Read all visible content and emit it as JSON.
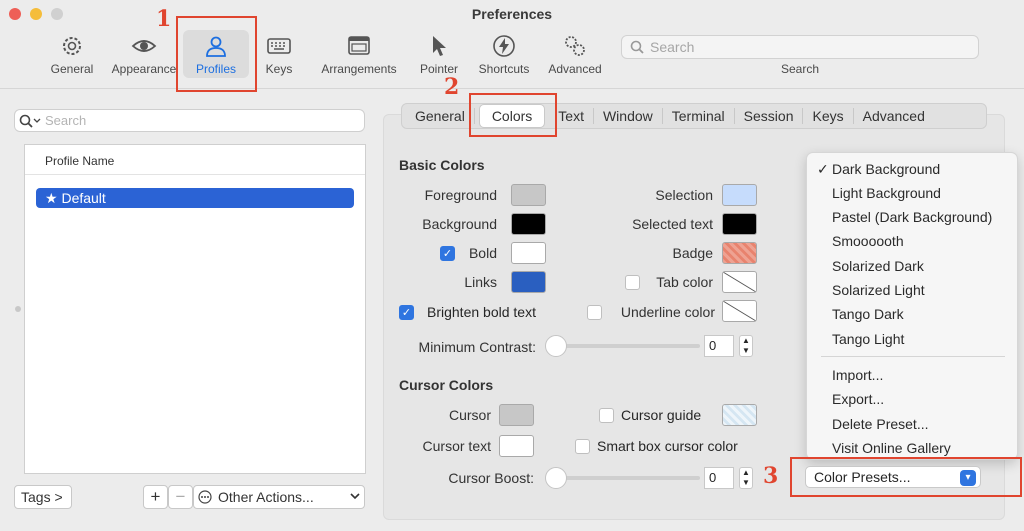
{
  "window": {
    "title": "Preferences"
  },
  "toolbar": [
    {
      "label": "General",
      "icon": "gear-icon"
    },
    {
      "label": "Appearance",
      "icon": "eye-icon"
    },
    {
      "label": "Profiles",
      "icon": "person-icon"
    },
    {
      "label": "Keys",
      "icon": "keyboard-icon"
    },
    {
      "label": "Arrangements",
      "icon": "window-icon"
    },
    {
      "label": "Pointer",
      "icon": "pointer-icon"
    },
    {
      "label": "Shortcuts",
      "icon": "bolt-icon"
    },
    {
      "label": "Advanced",
      "icon": "gears-icon"
    }
  ],
  "search": {
    "placeholder": "Search",
    "label": "Search"
  },
  "profiles": {
    "search_placeholder": "Search",
    "column": "Profile Name",
    "items": [
      "Default"
    ],
    "tags_button": "Tags >",
    "add": "+",
    "remove": "−",
    "other_actions": "Other Actions..."
  },
  "tabs": [
    "General",
    "Colors",
    "Text",
    "Window",
    "Terminal",
    "Session",
    "Keys",
    "Advanced"
  ],
  "basic": {
    "title": "Basic Colors",
    "foreground": "Foreground",
    "background": "Background",
    "bold": "Bold",
    "links": "Links",
    "brighten": "Brighten bold text",
    "selection": "Selection",
    "selected_text": "Selected text",
    "badge": "Badge",
    "tab_color": "Tab color",
    "underline": "Underline color",
    "min_contrast": "Minimum Contrast:",
    "min_contrast_value": "0"
  },
  "cursor": {
    "title": "Cursor Colors",
    "cursor": "Cursor",
    "cursor_text": "Cursor text",
    "guide": "Cursor guide",
    "smart": "Smart box cursor color",
    "boost": "Cursor Boost:",
    "boost_value": "0"
  },
  "colors": {
    "foreground": "#c7c7c7",
    "background": "#000000",
    "bold": "#ffffff",
    "links": "#2a5fc0",
    "selection": "#c6dcfc",
    "selected_text": "#000000",
    "badge": "#e8836e",
    "cursor": "#c7c7c7",
    "cursor_text": "#ffffff",
    "accent": "#2f75e0",
    "highlight": "#e0452f"
  },
  "menu": {
    "presets": [
      "Dark Background",
      "Light Background",
      "Pastel (Dark Background)",
      "Smoooooth",
      "Solarized Dark",
      "Solarized Light",
      "Tango Dark",
      "Tango Light"
    ],
    "selected": "Dark Background",
    "actions": [
      "Import...",
      "Export...",
      "Delete Preset...",
      "Visit Online Gallery"
    ],
    "button": "Color Presets..."
  },
  "annotations": [
    "1",
    "2",
    "3"
  ]
}
